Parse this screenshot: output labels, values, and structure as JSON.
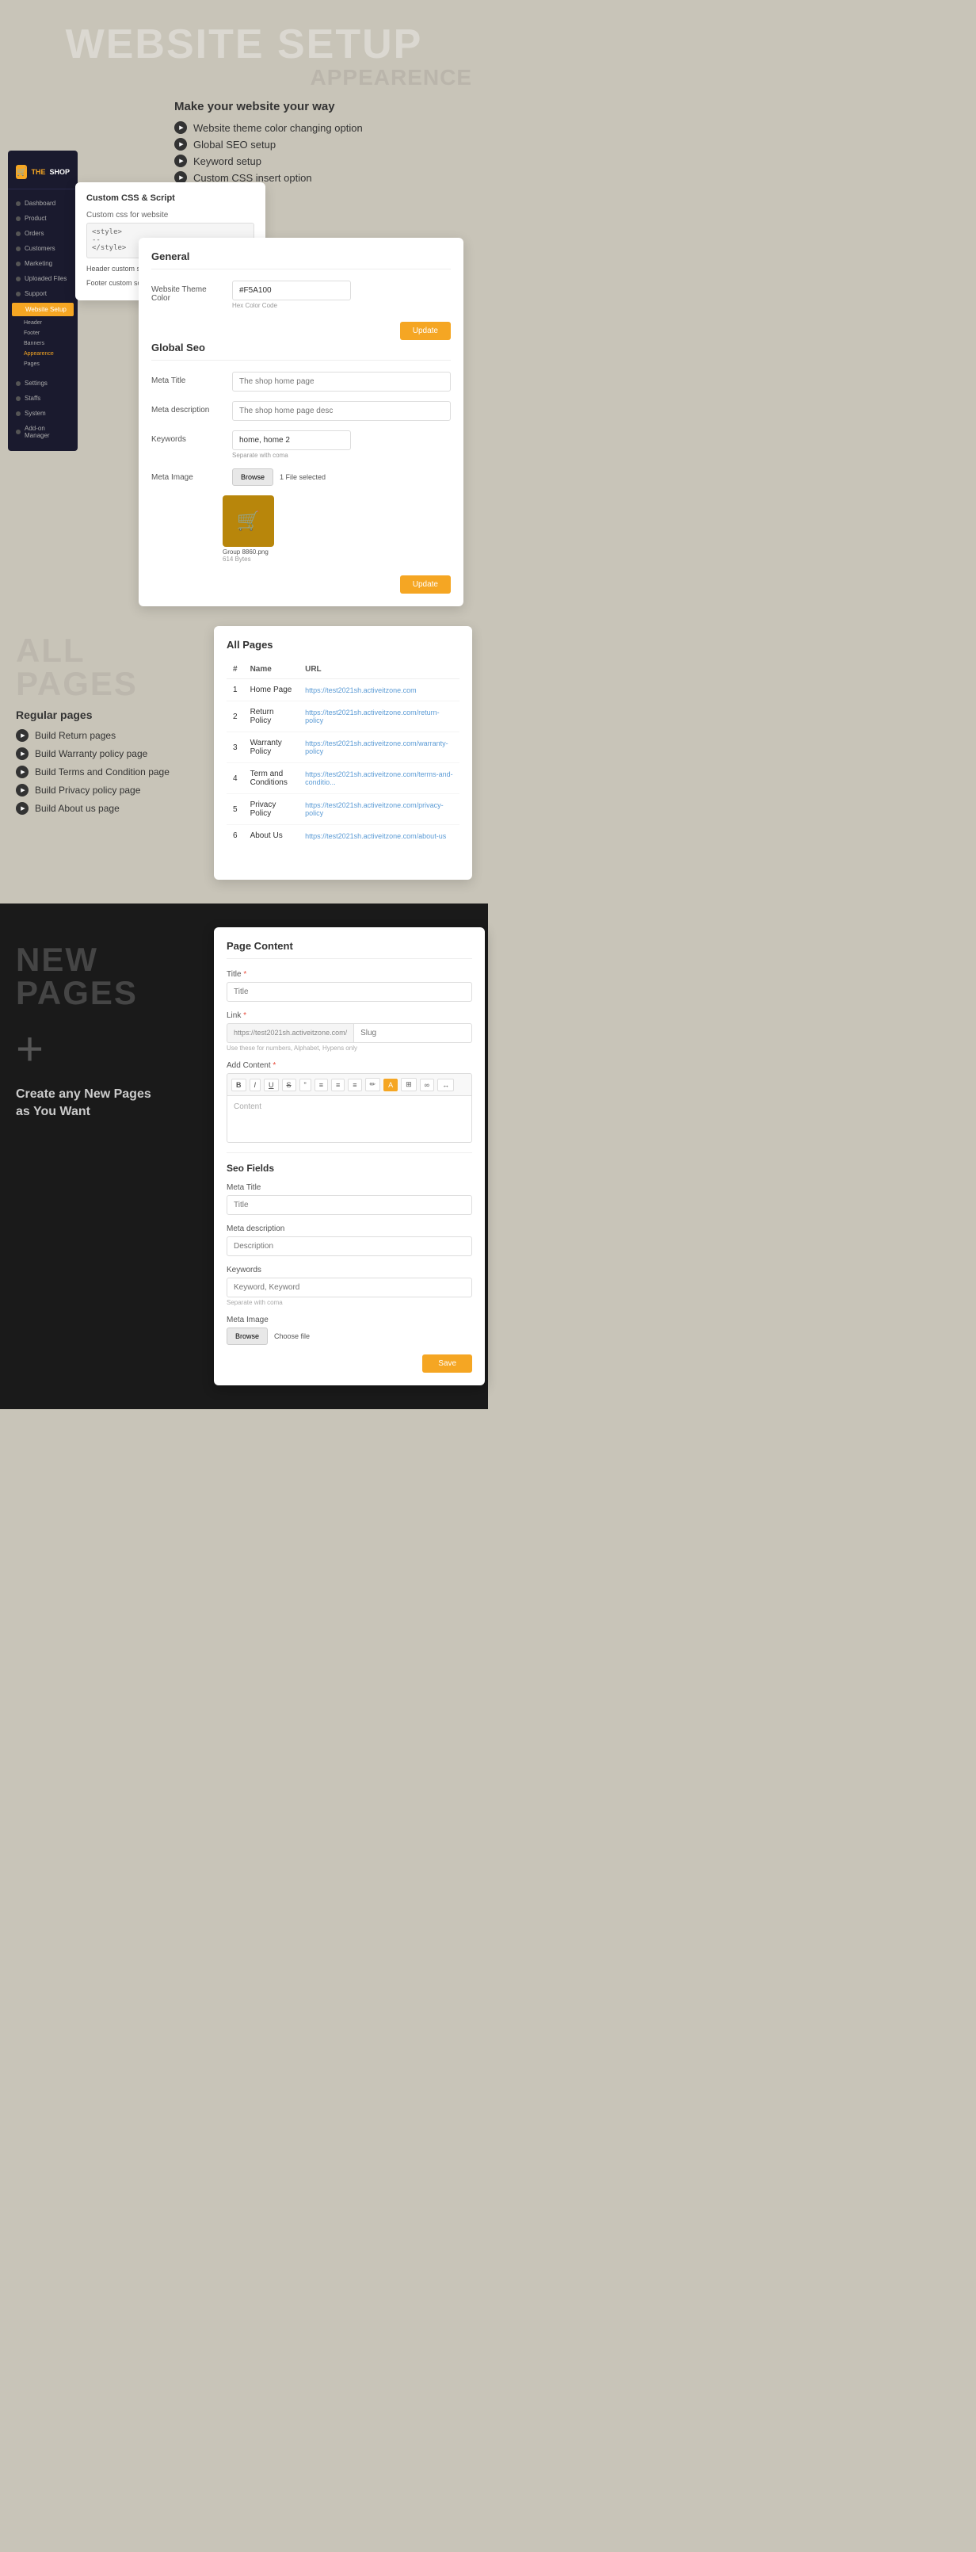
{
  "hero": {
    "title": "WEBSITE SETUP",
    "subtitle": "APPEARENCE",
    "tagline": "Make your website your way",
    "features": [
      "Website theme color changing option",
      "Global SEO setup",
      "Keyword setup",
      "Custom CSS insert option"
    ]
  },
  "admin": {
    "logo": {
      "the": "THE",
      "shop": "SHOP"
    },
    "nav": [
      {
        "label": "Dashboard",
        "active": false
      },
      {
        "label": "Product",
        "active": false
      },
      {
        "label": "Orders",
        "active": false
      },
      {
        "label": "Customers",
        "active": false
      },
      {
        "label": "Marketing",
        "active": false
      },
      {
        "label": "Uploaded Files",
        "active": false
      },
      {
        "label": "Support",
        "active": false
      },
      {
        "label": "Website Setup",
        "active": true,
        "highlight": true
      }
    ],
    "subnav": [
      {
        "label": "Header",
        "active": false
      },
      {
        "label": "Footer",
        "active": false
      },
      {
        "label": "Banners",
        "active": false
      },
      {
        "label": "Appearence",
        "active": true
      },
      {
        "label": "Pages",
        "active": false
      }
    ],
    "bottomNav": [
      {
        "label": "Settings"
      },
      {
        "label": "Staffs"
      },
      {
        "label": "System"
      },
      {
        "label": "Add-on Manager"
      }
    ]
  },
  "cssCard": {
    "title": "Custom CSS & Script",
    "label": "Custom css for website",
    "placeholder1": "<style>",
    "placeholder2": "--",
    "placeholder3": "</style>",
    "headerScriptLabel": "Header custom script - before </head>",
    "footerScriptLabel": "Footer custom script - before </body>"
  },
  "generalCard": {
    "sectionTitle": "General",
    "fields": [
      {
        "label": "Website Theme Color",
        "value": "#F5A100",
        "hint": "Hex Color Code"
      }
    ],
    "updateBtn": "Update",
    "seoTitle": "Global Seo",
    "seoFields": [
      {
        "label": "Meta Title",
        "placeholder": "The shop home page"
      },
      {
        "label": "Meta description",
        "placeholder": "The shop home page desc"
      },
      {
        "label": "Keywords",
        "value": "home, home 2",
        "hint": "Separate with coma"
      },
      {
        "label": "Meta Image",
        "browse": "Browse",
        "fileSelected": "1 File selected"
      }
    ],
    "imagePreview": {
      "name": "Group 8860.png",
      "size": "614 Bytes"
    },
    "updateBtn2": "Update"
  },
  "allPages": {
    "bigTitle": "ALL PAGES",
    "subtitle": "Regular pages",
    "features": [
      "Build Return pages",
      "Build Warranty policy page",
      "Build Terms and Condition page",
      "Build Privacy policy page",
      "Build About us page"
    ],
    "tableTitle": "All Pages",
    "tableHeaders": [
      "#",
      "Name",
      "URL"
    ],
    "tableRows": [
      {
        "num": "1",
        "name": "Home Page",
        "url": "https://test2021sh.activeitzone.com"
      },
      {
        "num": "2",
        "name": "Return Policy",
        "url": "https://test2021sh.activeitzone.com/return-policy"
      },
      {
        "num": "3",
        "name": "Warranty Policy",
        "url": "https://test2021sh.activeitzone.com/warranty-policy"
      },
      {
        "num": "4",
        "name": "Term and Conditions",
        "url": "https://test2021sh.activeitzone.com/terms-and-conditio..."
      },
      {
        "num": "5",
        "name": "Privacy Policy",
        "url": "https://test2021sh.activeitzone.com/privacy-policy"
      },
      {
        "num": "6",
        "name": "About Us",
        "url": "https://test2021sh.activeitzone.com/about-us"
      }
    ]
  },
  "newPages": {
    "bigTitle": "NEW PAGES",
    "plusSymbol": "+",
    "description": "Create any New Pages\nas You Want",
    "pageContentCard": {
      "title": "Page Content",
      "fields": {
        "title": {
          "label": "Title",
          "required": true,
          "placeholder": "Title"
        },
        "link": {
          "label": "Link",
          "required": true,
          "prefix": "https://test2021sh.activeitzone.com/",
          "placeholder": "Slug",
          "hint": "Use these for numbers, Alphabet, Hypens only"
        },
        "content": {
          "label": "Add Content",
          "required": true,
          "placeholder": "Content",
          "toolbarBtns": [
            "B",
            "I",
            "U",
            "S",
            "\"",
            "≡",
            "≡",
            "≡",
            "✏",
            "A",
            "⊞",
            "∞",
            "↔"
          ]
        }
      },
      "seoSection": {
        "title": "Seo Fields",
        "fields": [
          {
            "label": "Meta Title",
            "placeholder": "Title"
          },
          {
            "label": "Meta description",
            "placeholder": "Description"
          },
          {
            "label": "Keywords",
            "placeholder": "Keyword, Keyword",
            "hint": "Separate with coma"
          },
          {
            "label": "Meta Image",
            "browse": "Browse",
            "choose": "Choose file"
          }
        ]
      },
      "saveBtn": "Save"
    }
  }
}
